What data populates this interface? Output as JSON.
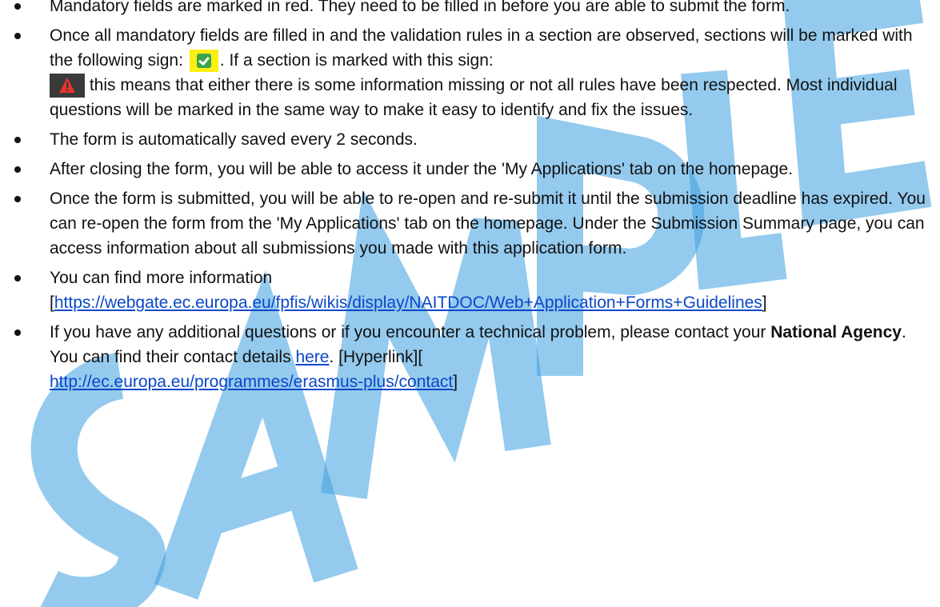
{
  "items": [
    {
      "text": "Mandatory fields are marked in red. They need to be filled in before you are able to submit the form."
    },
    {
      "part1": "Once all mandatory fields are filled in and the validation rules in a section are observed, sections will be marked with the following sign:",
      "part2": ". If a section is marked with this sign:",
      "part3": "this means that either there is some information missing or not all rules have been respected. Most individual questions will be marked in the same way to make it easy to identify and fix the issues.",
      "valid_icon": "validated-checkbox-icon",
      "warn_icon": "warning-triangle-icon"
    },
    {
      "text": "The form is automatically saved every 2 seconds."
    },
    {
      "text": "After closing the form, you will be able to access it under the 'My Applications' tab on the homepage."
    },
    {
      "text": "Once the form is submitted, you will be able to re-open and re-submit it until the submission deadline has expired. You can re-open the form from the 'My Applications' tab on the homepage. Under the Submission Summary page, you can access information about all submissions you made with this application form."
    },
    {
      "text": "You can find more information",
      "bracket_open": "[",
      "link": "https://webgate.ec.europa.eu/fpfis/wikis/display/NAITDOC/Web+Application+Forms+Guidelines",
      "bracket_close": "]"
    },
    {
      "part1": "If you have any additional questions or if you encounter a technical problem, please contact your",
      "bold": "National Agency",
      "part2": ". You can find their contact details",
      "link_here": "here",
      "part3": ". [Hyperlink][",
      "link": "http://ec.europa.eu/programmes/erasmus-plus/contact",
      "bracket_close": "]"
    }
  ],
  "watermark": {
    "text": "SAMPLE",
    "color": "#3d9ee0"
  },
  "colors": {
    "link": "#0a47c9",
    "valid_bg": "#ffee11",
    "valid_box": "#3aa64a",
    "warn_bg": "#3a3a3a",
    "warn_triangle": "#e8332f"
  }
}
